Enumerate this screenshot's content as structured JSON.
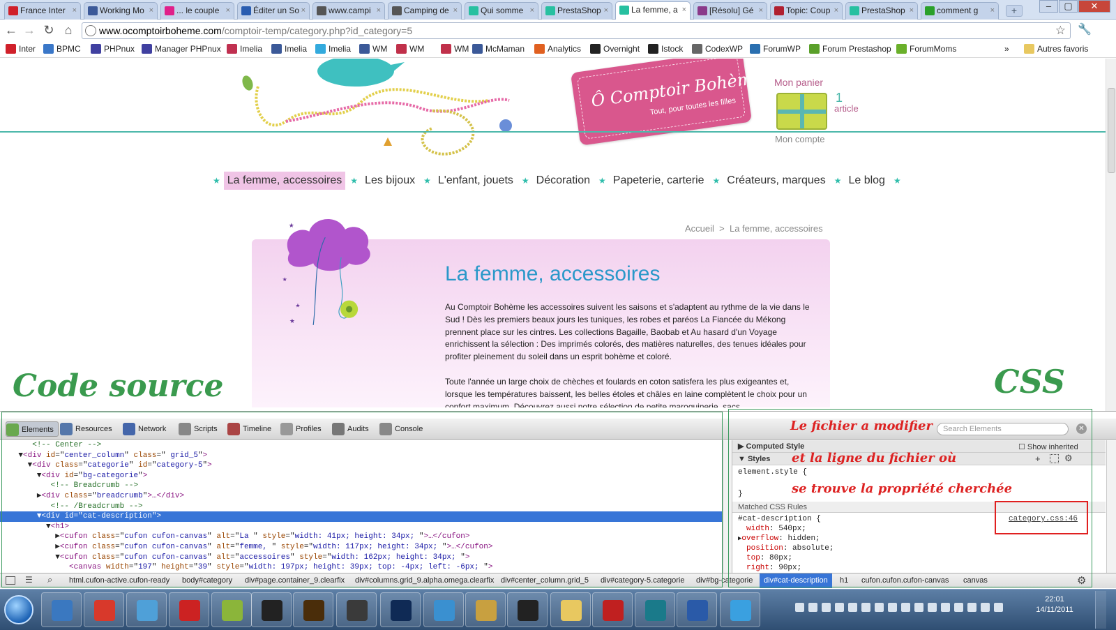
{
  "browser": {
    "tabs": [
      {
        "label": "France Inter",
        "color": "#d0202a"
      },
      {
        "label": "Working Mo",
        "color": "#3b5998"
      },
      {
        "label": "... le couple",
        "color": "#e0208a"
      },
      {
        "label": "Éditer un So",
        "color": "#2a5db0"
      },
      {
        "label": "www.campi",
        "color": "#555555"
      },
      {
        "label": "Camping de",
        "color": "#555555"
      },
      {
        "label": "Qui somme",
        "color": "#27c0a0"
      },
      {
        "label": "PrestaShop",
        "color": "#27c0a0"
      },
      {
        "label": "La femme, a",
        "color": "#27c0a0"
      },
      {
        "label": "[Résolu] Gé",
        "color": "#8a3a8a"
      },
      {
        "label": "Topic: Coup",
        "color": "#b02030"
      },
      {
        "label": "PrestaShop",
        "color": "#27c0a0"
      },
      {
        "label": "comment g",
        "color": "#2aa02a"
      }
    ],
    "new_tab_label": "+",
    "window_controls": [
      "–",
      "▢",
      "✕"
    ],
    "url_host": "www.ocomptoirboheme.com",
    "url_path": "/comptoir-temp/category.php?id_category=5",
    "bookmarks": [
      {
        "label": "Inter",
        "color": "#d0202a"
      },
      {
        "label": "BPMC",
        "color": "#3a77c8"
      },
      {
        "label": "PHPnux",
        "color": "#4040a0"
      },
      {
        "label": "Manager PHPnux",
        "color": "#4040a0"
      },
      {
        "label": "Imelia",
        "color": "#c03050"
      },
      {
        "label": "Imelia",
        "color": "#3b5998"
      },
      {
        "label": "Imelia",
        "color": "#33aadd"
      },
      {
        "label": "WM",
        "color": "#3b5998"
      },
      {
        "label": "WM",
        "color": "#c0304a"
      },
      {
        "label": "WM",
        "color": "#c0304a"
      },
      {
        "label": "McMaman",
        "color": "#3b5998"
      },
      {
        "label": "Analytics",
        "color": "#e06020"
      },
      {
        "label": "Overnight",
        "color": "#222222"
      },
      {
        "label": "Istock",
        "color": "#222222"
      },
      {
        "label": "CodexWP",
        "color": "#666666"
      },
      {
        "label": "ForumWP",
        "color": "#2a6fb0"
      },
      {
        "label": "Forum Prestashop",
        "color": "#5aa02a"
      },
      {
        "label": "ForumMoms",
        "color": "#6ab02a"
      }
    ],
    "bookmarks_more": "»",
    "other_bookmarks": "Autres favoris"
  },
  "site": {
    "logo_title": "Ô Comptoir Bohème",
    "logo_tagline": "Tout, pour toutes les filles",
    "cart_label": "Mon panier",
    "cart_count": "1",
    "cart_unit": "article",
    "account_label": "Mon compte",
    "menu": [
      "La femme, accessoires",
      "Les bijoux",
      "L'enfant, jouets",
      "Décoration",
      "Papeterie, carterie",
      "Créateurs, marques",
      "Le blog"
    ],
    "breadcrumb_home": "Accueil",
    "breadcrumb_sep": ">",
    "breadcrumb_current": "La femme, accessoires",
    "category_title": "La femme, accessoires",
    "paragraph1": "Au Comptoir Bohème les accessoires suivent les saisons et s'adaptent au rythme de la vie dans le Sud ! Dès les premiers beaux jours les tuniques, les robes et paréos La Fiancée du Mékong prennent place sur les cintres. Les collections Bagaille, Baobab et Au hasard d'un Voyage enrichissent la sélection : Des imprimés colorés, des matières naturelles, des tenues idéales pour profiter pleinement du soleil dans un esprit bohème et coloré.",
    "paragraph2": "Toute l'année un large choix de chèches et foulards en coton satisfera les plus exigeantes et, lorsque les températures baissent, les belles étoles et châles en laine complètent le choix pour un confort maximum. Découvrez aussi notre sélection de petite maroquinerie, sacs,"
  },
  "annotations": {
    "code_source": "Code source",
    "css": "CSS",
    "file_line1": "Le fichier a modifier",
    "file_line2": "et la ligne du fichier où",
    "file_line3": "se trouve la propriété cherchée"
  },
  "devtools": {
    "tabs": [
      {
        "label": "Elements",
        "color": "#6aa84f"
      },
      {
        "label": "Resources",
        "color": "#5577aa"
      },
      {
        "label": "Network",
        "color": "#4466aa"
      },
      {
        "label": "Scripts",
        "color": "#888888"
      },
      {
        "label": "Timeline",
        "color": "#aa4444"
      },
      {
        "label": "Profiles",
        "color": "#999999"
      },
      {
        "label": "Audits",
        "color": "#777777"
      },
      {
        "label": "Console",
        "color": "#888888"
      }
    ],
    "search_placeholder": "Search Elements",
    "code_lines": [
      {
        "indent": "      ",
        "toggle": "",
        "text": "<!-- Center -->",
        "kind": "comment"
      },
      {
        "indent": "    ",
        "toggle": "▼",
        "tag": "div",
        "attrs": [
          [
            "id",
            "center_column"
          ],
          [
            "class",
            " grid_5"
          ]
        ]
      },
      {
        "indent": "      ",
        "toggle": "▼",
        "tag": "div",
        "attrs": [
          [
            "class",
            "categorie"
          ],
          [
            "id",
            "category-5"
          ]
        ]
      },
      {
        "indent": "        ",
        "toggle": "▼",
        "tag": "div",
        "attrs": [
          [
            "id",
            "bg-categorie"
          ]
        ]
      },
      {
        "indent": "          ",
        "toggle": "",
        "text": "<!-- Breadcrumb -->",
        "kind": "comment"
      },
      {
        "indent": "        ",
        "toggle": "▶",
        "tag": "div",
        "attrs": [
          [
            "class",
            "breadcrumb"
          ]
        ],
        "tail": "…</div>"
      },
      {
        "indent": "          ",
        "toggle": "",
        "text": "<!-- /Breadcrumb -->",
        "kind": "comment"
      },
      {
        "indent": "        ",
        "toggle": "▼",
        "tag": "div",
        "attrs": [
          [
            "id",
            "cat-description"
          ]
        ],
        "selected": true
      },
      {
        "indent": "          ",
        "toggle": "▼",
        "tag": "h1",
        "attrs": []
      },
      {
        "indent": "            ",
        "toggle": "▶",
        "tag": "cufon",
        "attrs": [
          [
            "class",
            "cufon cufon-canvas"
          ],
          [
            "alt",
            "La "
          ],
          [
            "style",
            "width: 41px; height: 34px; "
          ]
        ],
        "tail": "…</cufon>"
      },
      {
        "indent": "            ",
        "toggle": "▶",
        "tag": "cufon",
        "attrs": [
          [
            "class",
            "cufon cufon-canvas"
          ],
          [
            "alt",
            "femme, "
          ],
          [
            "style",
            "width: 117px; height: 34px; "
          ]
        ],
        "tail": "…</cufon>"
      },
      {
        "indent": "            ",
        "toggle": "▼",
        "tag": "cufon",
        "attrs": [
          [
            "class",
            "cufon cufon-canvas"
          ],
          [
            "alt",
            "accessoires"
          ],
          [
            "style",
            "width: 162px; height: 34px; "
          ]
        ]
      },
      {
        "indent": "              ",
        "toggle": "",
        "tag": "canvas",
        "attrs": [
          [
            "width",
            "197"
          ],
          [
            "height",
            "39"
          ],
          [
            "style",
            "width: 197px; height: 39px; top: -4px; left: -6px; "
          ]
        ]
      }
    ],
    "computed_style": "Computed Style",
    "show_inherited": "Show inherited",
    "styles_header": "Styles",
    "element_style_open": "element.style {",
    "element_style_close": "}",
    "matched_rules": "Matched CSS Rules",
    "rule_selector": "#cat-description {",
    "rule_link": "category.css:46",
    "rule_props": [
      [
        "width",
        "540px;"
      ],
      [
        "overflow",
        "hidden;"
      ],
      [
        "position",
        "absolute;"
      ],
      [
        "top",
        "80px;"
      ],
      [
        "right",
        "90px;"
      ]
    ],
    "status_crumbs": [
      "html.cufon-active.cufon-ready",
      "body#category",
      "div#page.container_9.clearfix",
      "div#columns.grid_9.alpha.omega.clearfix",
      "div#center_column.grid_5",
      "div#category-5.categorie",
      "div#bg-categorie",
      "div#cat-description",
      "h1",
      "cufon.cufon.cufon-canvas",
      "canvas"
    ]
  },
  "taskbar": {
    "apps": [
      {
        "name": "thunderbird-icon",
        "color": "#3a78c0"
      },
      {
        "name": "chrome-icon",
        "color": "#d8392b"
      },
      {
        "name": "messenger-icon",
        "color": "#4fa0d8"
      },
      {
        "name": "acrobat-icon",
        "color": "#cc2222"
      },
      {
        "name": "notepad-icon",
        "color": "#8bb53a"
      },
      {
        "name": "inkscape-icon",
        "color": "#222222"
      },
      {
        "name": "illustrator-icon",
        "color": "#4a2d0a"
      },
      {
        "name": "app-a-icon",
        "color": "#3a3a3a"
      },
      {
        "name": "photoshop-icon",
        "color": "#0f2a55"
      },
      {
        "name": "network-icon",
        "color": "#3a90d0"
      },
      {
        "name": "package-icon",
        "color": "#c8a040"
      },
      {
        "name": "studio-icon",
        "color": "#222222"
      },
      {
        "name": "folder-icon",
        "color": "#e8c860"
      },
      {
        "name": "filezilla-icon",
        "color": "#c02020"
      },
      {
        "name": "publisher-icon",
        "color": "#1a7a8a"
      },
      {
        "name": "word-icon",
        "color": "#2a5aa8"
      },
      {
        "name": "ie-icon",
        "color": "#3aa0e0"
      }
    ],
    "time": "22:01",
    "date": "14/11/2011"
  }
}
